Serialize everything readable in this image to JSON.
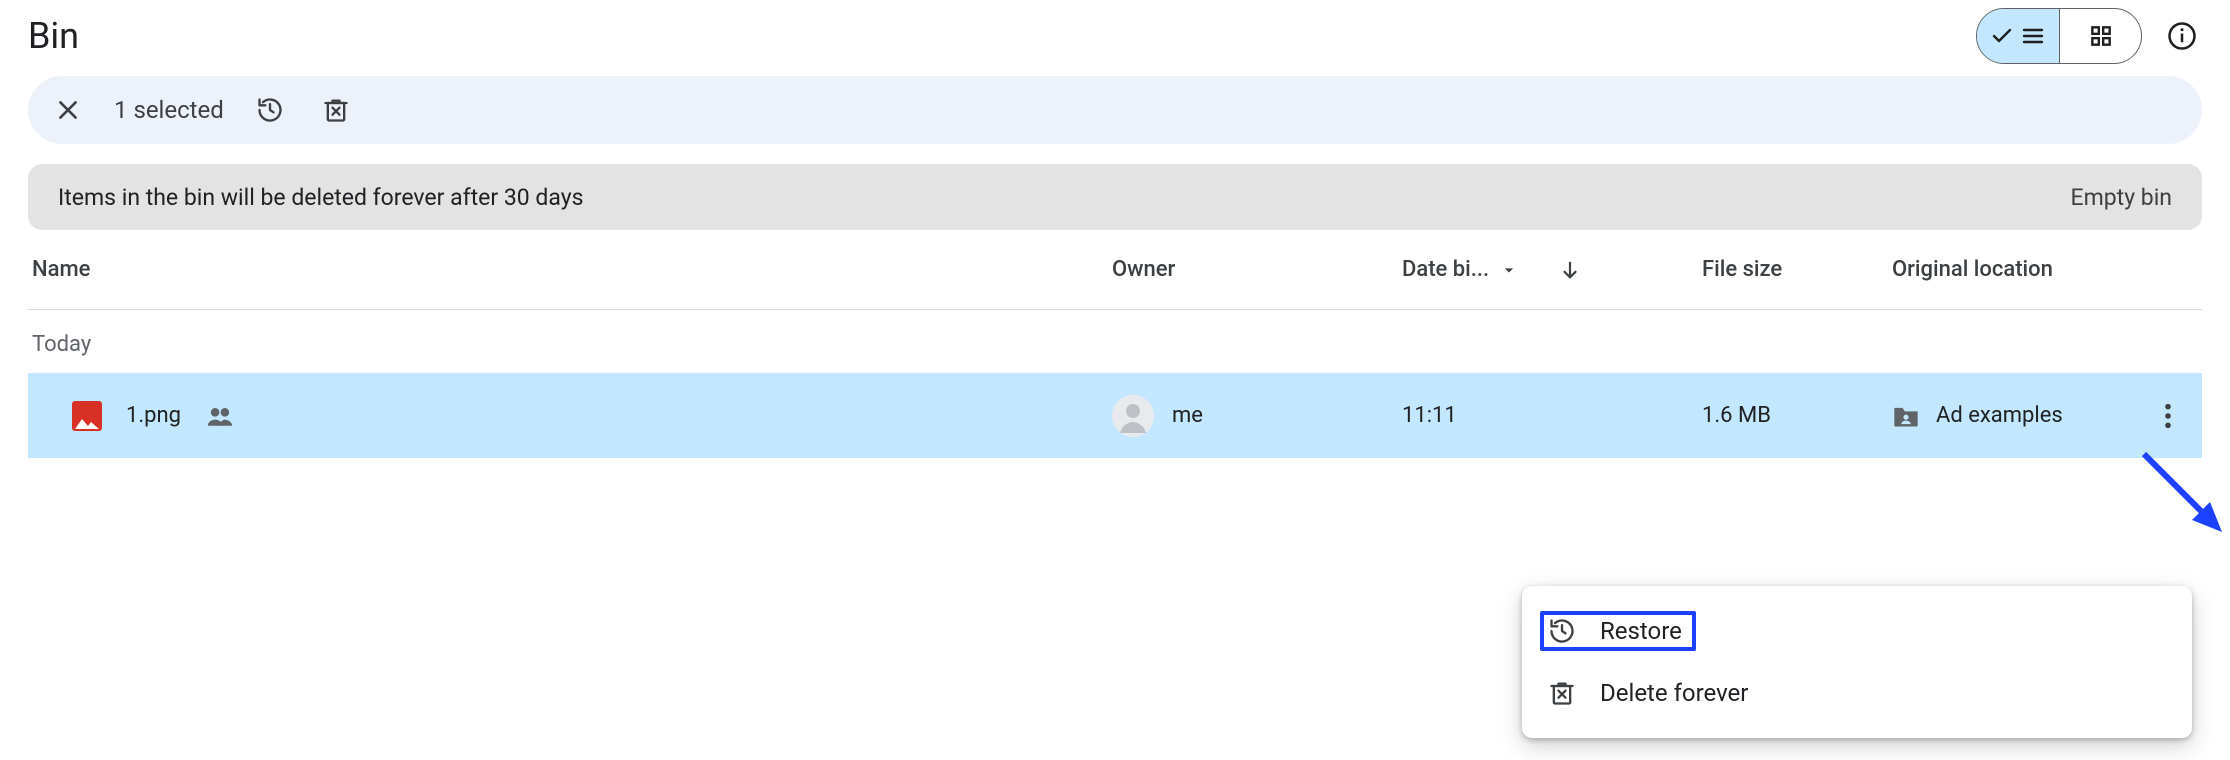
{
  "page_title": "Bin",
  "view_mode": "list",
  "selection_bar": {
    "count_label": "1 selected"
  },
  "notice": {
    "message": "Items in the bin will be deleted forever after 30 days",
    "empty_label": "Empty bin"
  },
  "columns": {
    "name": "Name",
    "owner": "Owner",
    "date": "Date bi...",
    "size": "File size",
    "location": "Original location"
  },
  "group_heading": "Today",
  "file": {
    "name": "1.png",
    "owner": "me",
    "date": "11:11",
    "size": "1.6 MB",
    "location": "Ad examples"
  },
  "menu": {
    "restore": "Restore",
    "delete_forever": "Delete forever"
  }
}
